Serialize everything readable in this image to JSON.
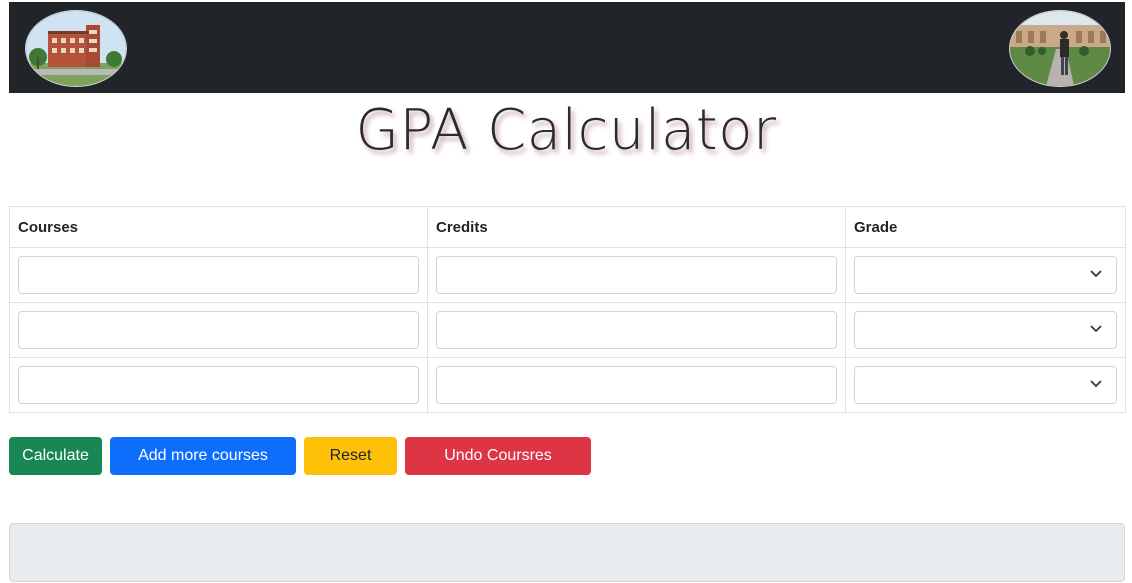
{
  "header": {
    "left_logo_icon": "building-photo",
    "right_logo_icon": "person-photo",
    "background": "#212529"
  },
  "title": "GPA Calculator",
  "table": {
    "columns": [
      "Courses",
      "Credits",
      "Grade"
    ],
    "rows": [
      {
        "course": "",
        "credits": "",
        "grade": ""
      },
      {
        "course": "",
        "credits": "",
        "grade": ""
      },
      {
        "course": "",
        "credits": "",
        "grade": ""
      }
    ]
  },
  "buttons": {
    "calculate": "Calculate",
    "add_more": "Add more courses",
    "reset": "Reset",
    "undo": "Undo Coursres"
  },
  "colors": {
    "calculate": "#198754",
    "add_more": "#0d6efd",
    "reset": "#ffc107",
    "undo": "#dc3545",
    "result_box": "#e9ecef"
  },
  "result": ""
}
